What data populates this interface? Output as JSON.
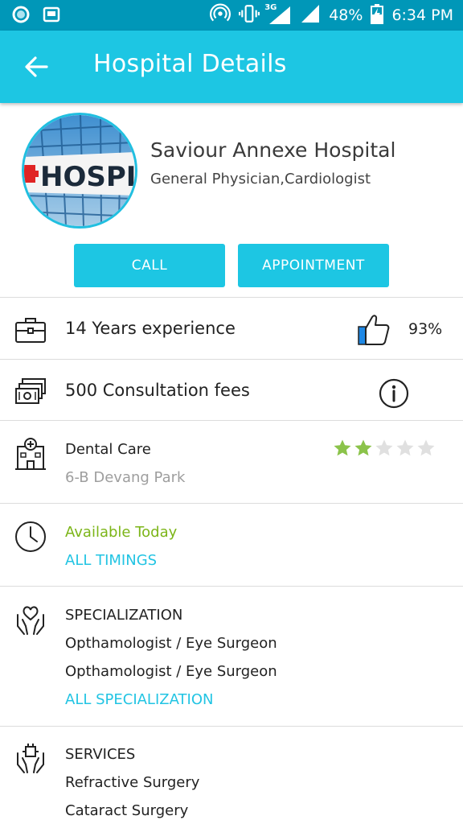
{
  "status_bar": {
    "network": "3G",
    "battery": "48%",
    "time": "6:34 PM"
  },
  "app_bar": {
    "title": "Hospital Details",
    "back_icon": "arrow-left-icon"
  },
  "profile": {
    "name": "Saviour Annexe Hospital",
    "specialties": "General Physician,Cardiologist",
    "image_label": "HOSPI"
  },
  "actions": {
    "call_label": "CALL",
    "appointment_label": "APPOINTMENT"
  },
  "experience": {
    "text": "14 Years experience",
    "rating_percent": "93%"
  },
  "fees": {
    "text": "500 Consultation fees"
  },
  "clinic": {
    "name": "Dental Care",
    "address": "6-B Devang Park",
    "rating": 2,
    "max_rating": 5
  },
  "availability": {
    "status": "Available Today",
    "link": "ALL TIMINGS"
  },
  "specialization": {
    "heading": "SPECIALIZATION",
    "items": [
      "Opthamologist / Eye Surgeon",
      "Opthamologist / Eye Surgeon"
    ],
    "link": "ALL SPECIALIZATION"
  },
  "services": {
    "heading": "SERVICES",
    "items": [
      "Refractive Surgery",
      "Cataract Surgery"
    ]
  },
  "colors": {
    "status_bar": "#0097b8",
    "primary": "#1dc6e3",
    "available": "#7cb518",
    "star_filled": "#8bc34a",
    "star_empty": "#e0e0e0"
  }
}
